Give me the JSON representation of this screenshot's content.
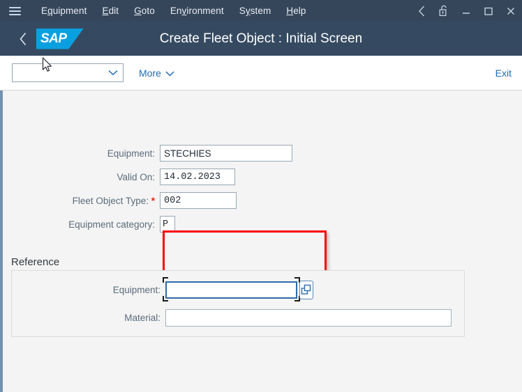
{
  "menubar": {
    "hamburger_icon": "hamburger-menu-icon",
    "items": [
      {
        "label": "Equipment",
        "accel": "q"
      },
      {
        "label": "Edit",
        "accel": "E"
      },
      {
        "label": "Goto",
        "accel": "G"
      },
      {
        "label": "Environment",
        "accel": "v"
      },
      {
        "label": "System",
        "accel": "y"
      },
      {
        "label": "Help",
        "accel": "H"
      }
    ],
    "window_controls": [
      {
        "name": "back-chevron-icon",
        "glyph": "‹"
      },
      {
        "name": "unlocked-padlock-icon",
        "glyph": ""
      },
      {
        "name": "minimize-icon",
        "glyph": "—"
      },
      {
        "name": "maximize-icon",
        "glyph": "□"
      },
      {
        "name": "close-icon",
        "glyph": "✕"
      }
    ]
  },
  "titlebar": {
    "back_label": "‹",
    "logo_text": "SAP",
    "title": "Create Fleet Object : Initial Screen"
  },
  "toolbar": {
    "select_value": "",
    "select_chevron": "∨",
    "more_label": "More",
    "more_chevron": "∨",
    "exit_label": "Exit"
  },
  "form": {
    "fields": [
      {
        "label": "Equipment:",
        "value": "STECHIES",
        "required": false
      },
      {
        "label": "Valid On:",
        "value": "14.02.2023",
        "required": false
      },
      {
        "label": "Fleet Object Type:",
        "value": "002",
        "required": true,
        "required_marker": "*"
      },
      {
        "label": "Equipment category:",
        "value": "P",
        "required": false
      }
    ]
  },
  "reference": {
    "title": "Reference",
    "equipment_label": "Equipment:",
    "equipment_value": "",
    "material_label": "Material:",
    "material_value": "",
    "value_help_icon": "value-help-icon"
  },
  "colors": {
    "menubar_bg": "#36465a",
    "titlebar_bg": "#354a61",
    "sap_blue": "#0aa0e0",
    "link_blue": "#1f6bb8",
    "highlight_red": "#fb0000",
    "required_red": "#e1261c",
    "content_bg": "#f4f4f4",
    "left_strip": "#7591b0"
  }
}
